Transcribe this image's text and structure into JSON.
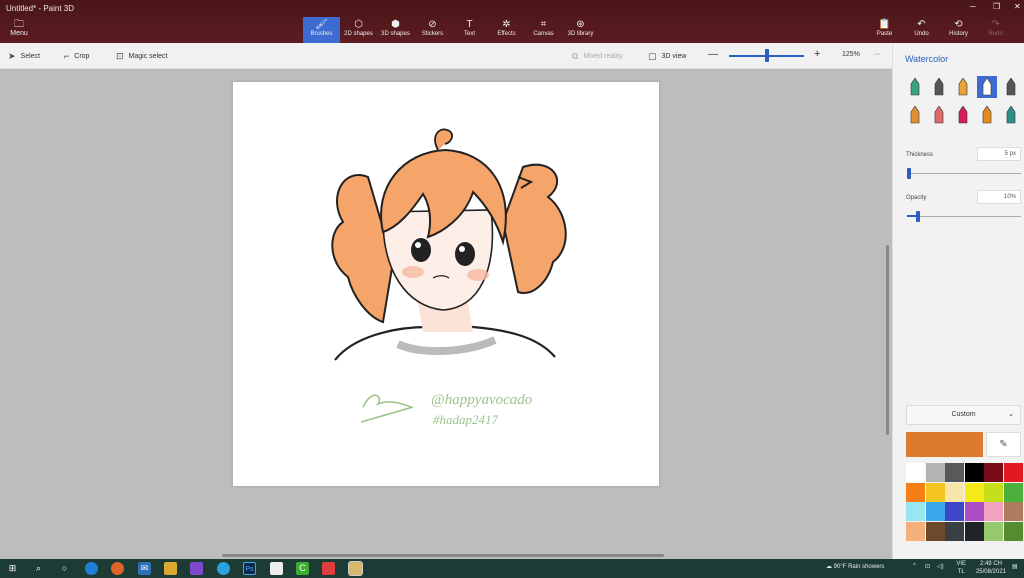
{
  "window": {
    "title": "Untitled* - Paint 3D",
    "minimize": "─",
    "maximize": "❐",
    "close": "✕"
  },
  "menu": {
    "label": "Menu",
    "icon": "menu-icon"
  },
  "tools": [
    {
      "label": "Brushes",
      "glyph": "🖌",
      "active": true
    },
    {
      "label": "2D shapes",
      "glyph": "⬡"
    },
    {
      "label": "3D shapes",
      "glyph": "⬢"
    },
    {
      "label": "Stickers",
      "glyph": "⊘"
    },
    {
      "label": "Text",
      "glyph": "T"
    },
    {
      "label": "Effects",
      "glyph": "✲"
    },
    {
      "label": "Canvas",
      "glyph": "⌗"
    },
    {
      "label": "3D library",
      "glyph": "⊛"
    }
  ],
  "right_tools": [
    {
      "label": "Paste",
      "glyph": "📋"
    },
    {
      "label": "Undo",
      "glyph": "↶"
    },
    {
      "label": "History",
      "glyph": "⟲"
    },
    {
      "label": "Redo",
      "glyph": "↷",
      "disabled": true
    }
  ],
  "toolbar": {
    "select": "Select",
    "crop": "Crop",
    "magic": "Magic select",
    "mixed": "Mixed reality",
    "view3d": "3D view",
    "zoom_minus": "—",
    "zoom_plus": "+",
    "zoom": "125%",
    "more": "···",
    "zoom_level": 0.5
  },
  "panel": {
    "title": "Watercolor",
    "thickness_label": "Thickness",
    "thickness_value": "5 px",
    "thickness_level": 0.02,
    "opacity_label": "Opacity",
    "opacity_value": "10%",
    "opacity_level": 0.1,
    "custom_label": "Custom",
    "current_color": "#dd7a2e",
    "brushes": [
      {
        "name": "marker-icon",
        "color": "#3aa37a"
      },
      {
        "name": "calligraphy-pen-icon",
        "color": "#555"
      },
      {
        "name": "oil-brush-icon",
        "color": "#e8a33a"
      },
      {
        "name": "watercolor-icon",
        "color": "#2b5fbf",
        "active": true
      },
      {
        "name": "pixel-pen-icon",
        "color": "#555"
      },
      {
        "name": "pencil-icon",
        "color": "#e0902f"
      },
      {
        "name": "eraser-icon",
        "color": "#e06a6a"
      },
      {
        "name": "crayon-icon",
        "color": "#d6205a"
      },
      {
        "name": "spray-can-icon",
        "color": "#e38b1e"
      },
      {
        "name": "fill-icon",
        "color": "#2f8f86"
      }
    ],
    "swatches": [
      "#ffffff",
      "#b3b3b3",
      "#595959",
      "#000000",
      "#7a0c1a",
      "#e11a22",
      "#f57f16",
      "#f4c520",
      "#f7e6a8",
      "#f5e917",
      "#c5e01b",
      "#4bb13c",
      "#98e6f0",
      "#39a7eb",
      "#4045c7",
      "#ad4bc4",
      "#f2a1bf",
      "#b07c5f",
      "#f3b07a",
      "#6b4a2c",
      "#384044",
      "#202428",
      "#98c86e",
      "#548c2f"
    ]
  },
  "canvas": {
    "signature_line1": "@happyavocado",
    "signature_line2": "#hadap2417"
  },
  "taskbar": {
    "weather": "90°F  Rain showers",
    "lang": "VIE",
    "time": "2:49 CH",
    "date": "25/08/2021"
  }
}
